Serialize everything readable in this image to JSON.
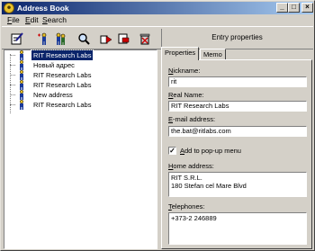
{
  "window": {
    "title": "Address Book"
  },
  "menu": [
    {
      "label": "File",
      "underline": "F",
      "rest": "ile"
    },
    {
      "label": "Edit",
      "underline": "E",
      "rest": "dit"
    },
    {
      "label": "Search",
      "underline": "S",
      "rest": "earch"
    }
  ],
  "toolbar": {
    "banner": "Entry properties",
    "buttons": [
      "edit-icon",
      "add-person-icon",
      "add-group-icon",
      "find-icon",
      "forward-icon",
      "move-icon",
      "delete-icon"
    ]
  },
  "tree": {
    "items": [
      {
        "label": "RIT Research Labs",
        "selected": true
      },
      {
        "label": "Новый адрес",
        "selected": false
      },
      {
        "label": "RIT Research Labs",
        "selected": false
      },
      {
        "label": "RIT Research Labs",
        "selected": false
      },
      {
        "label": "New address",
        "selected": false
      },
      {
        "label": "RIT Research Labs",
        "selected": false
      }
    ]
  },
  "tabs": [
    {
      "label": "Properties",
      "active": true
    },
    {
      "label": "Memo",
      "active": false
    }
  ],
  "properties": {
    "nickname": {
      "label_u": "N",
      "label_rest": "ickname:",
      "value": "rit"
    },
    "real_name": {
      "label_u": "R",
      "label_rest": "eal Name:",
      "value": "RIT Research Labs"
    },
    "email": {
      "label_u": "E",
      "label_rest": "-mail address:",
      "value": "the.bat@ritlabs.com"
    },
    "popup": {
      "label_u": "A",
      "label_rest": "dd to pop-up menu",
      "checked": true
    },
    "home": {
      "label_u": "H",
      "label_rest": "ome address:",
      "value": "RIT S.R.L.\n180 Stefan cel Mare Blvd"
    },
    "phones": {
      "label_u": "T",
      "label_rest": "elephones:",
      "value": "+373-2 246889"
    }
  }
}
